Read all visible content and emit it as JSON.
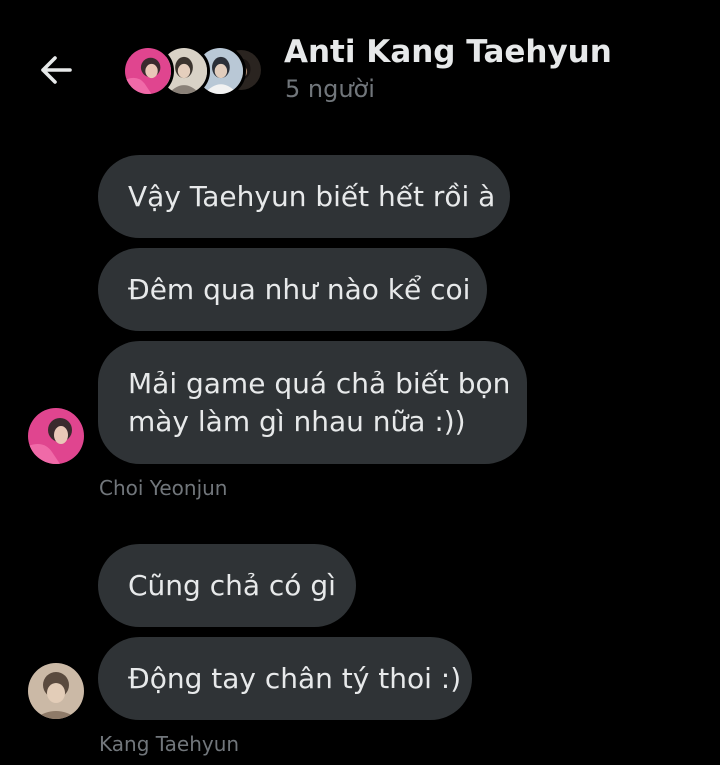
{
  "header": {
    "back_icon": "arrow-left-icon",
    "title": "Anti Kang Taehyun",
    "subtitle": "5 người",
    "participant_avatars": [
      "avatar-pink",
      "avatar-light",
      "avatar-blue",
      "avatar-dark"
    ]
  },
  "messages": [
    {
      "text": "Vậy Taehyun biết hết rồi à"
    },
    {
      "text": "Đêm qua như nào kể coi"
    },
    {
      "lines": [
        "Mải game quá chả biết bọn",
        "mày làm gì nhau nữa :))"
      ]
    },
    {
      "text": "Cũng chả có gì"
    },
    {
      "text": "Động tay chân tý thoi :)"
    }
  ],
  "senders": [
    {
      "name": "Choi Yeonjun",
      "avatar": "avatar-pink"
    },
    {
      "name": "Kang Taehyun",
      "avatar": "avatar-beige"
    }
  ],
  "colors": {
    "background": "#000000",
    "bubble": "#2f3336",
    "text": "#e7e9ea",
    "muted": "#71767b",
    "avatar_pink": "#e0458f"
  }
}
